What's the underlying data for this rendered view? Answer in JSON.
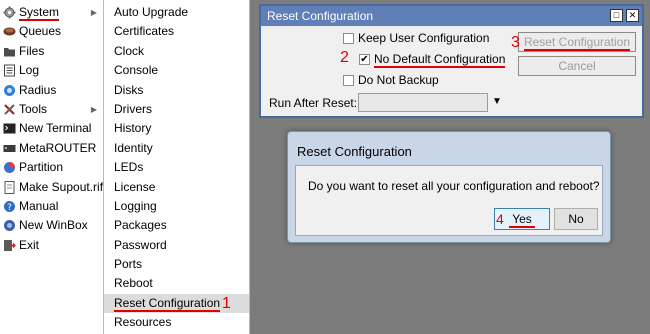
{
  "menu": {
    "items": [
      {
        "label": "System",
        "icon": "gear-icon",
        "has_submenu": true
      },
      {
        "label": "Queues",
        "icon": "queues-icon"
      },
      {
        "label": "Files",
        "icon": "folder-icon"
      },
      {
        "label": "Log",
        "icon": "log-icon"
      },
      {
        "label": "Radius",
        "icon": "radius-icon"
      },
      {
        "label": "Tools",
        "icon": "tools-icon",
        "has_submenu": true
      },
      {
        "label": "New Terminal",
        "icon": "terminal-icon"
      },
      {
        "label": "MetaROUTER",
        "icon": "metarouter-icon"
      },
      {
        "label": "Partition",
        "icon": "partition-icon"
      },
      {
        "label": "Make Supout.rif",
        "icon": "supout-icon"
      },
      {
        "label": "Manual",
        "icon": "manual-icon"
      },
      {
        "label": "New WinBox",
        "icon": "winbox-icon"
      },
      {
        "label": "Exit",
        "icon": "exit-icon"
      }
    ]
  },
  "submenu": {
    "items": [
      "Auto Upgrade",
      "Certificates",
      "Clock",
      "Console",
      "Disks",
      "Drivers",
      "History",
      "Identity",
      "LEDs",
      "License",
      "Logging",
      "Packages",
      "Password",
      "Ports",
      "Reboot",
      "Reset Configuration",
      "Resources"
    ]
  },
  "annotations": {
    "step1": "1",
    "step2": "2",
    "step3": "3",
    "step4": "4"
  },
  "reset_window": {
    "title": "Reset Configuration",
    "keep_user_config": "Keep User Configuration",
    "no_default_config": "No Default Configuration",
    "do_not_backup": "Do Not Backup",
    "run_after_reset_label": "Run After Reset:",
    "run_after_reset_value": "",
    "reset_button": "Reset Configuration",
    "cancel_button": "Cancel",
    "checkbox_states": {
      "keep_user_config": false,
      "no_default_config": true,
      "do_not_backup": false
    }
  },
  "confirm_dialog": {
    "title": "Reset Configuration",
    "message": "Do you want to reset all your configuration and reboot?",
    "yes_button": "Yes",
    "no_button": "No"
  },
  "colors": {
    "annotation_red": "#e00000",
    "title_bar_blue": "#5f7fb6",
    "dialog_frame": "#c8d6e7"
  }
}
